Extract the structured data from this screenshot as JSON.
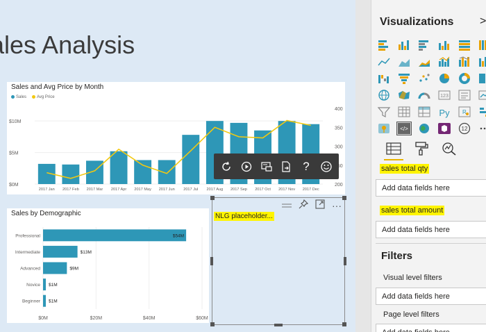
{
  "page": {
    "title": "ales Analysis"
  },
  "combo_chart": {
    "title": "Sales and Avg Price by Month",
    "legend": [
      {
        "label": "Sales",
        "color": "#2e97b7"
      },
      {
        "label": "Avg Price",
        "color": "#f2c811"
      }
    ],
    "y_left_ticks": [
      "$10M",
      "$5M",
      "$0M"
    ],
    "y_right_ticks": [
      "400",
      "350",
      "300",
      "250",
      "200"
    ]
  },
  "bar_chart": {
    "title": "Sales by Demographic",
    "x_ticks": [
      "$0M",
      "$20M",
      "$40M",
      "$60M"
    ]
  },
  "chart_data": [
    {
      "type": "bar",
      "title": "Sales and Avg Price by Month",
      "categories": [
        "2017 Jan",
        "2017 Feb",
        "2017 Mar",
        "2017 Apr",
        "2017 May",
        "2017 Jun",
        "2017 Jul",
        "2017 Aug",
        "2017 Sep",
        "2017 Oct",
        "2017 Nov",
        "2017 Dec"
      ],
      "series": [
        {
          "name": "Sales",
          "type": "bar",
          "axis": "left",
          "values": [
            3.2,
            3.1,
            3.7,
            5.2,
            3.8,
            3.8,
            7.8,
            10.0,
            9.7,
            8.5,
            10.0,
            9.5
          ]
        },
        {
          "name": "Avg Price",
          "type": "line",
          "axis": "right",
          "values": [
            230,
            215,
            235,
            292,
            250,
            228,
            288,
            350,
            325,
            322,
            368,
            355
          ]
        }
      ],
      "ylim_left": [
        0,
        12
      ],
      "ylim_right": [
        200,
        400
      ],
      "legend_position": "top-left"
    },
    {
      "type": "bar",
      "orientation": "horizontal",
      "title": "Sales by Demographic",
      "categories": [
        "Professional",
        "Intermediate",
        "Advanced",
        "Novice",
        "Beginner"
      ],
      "values": [
        54,
        13,
        9,
        1,
        1
      ],
      "value_labels": [
        "$54M",
        "$13M",
        "$9M",
        "$1M",
        "$1M"
      ],
      "xlim": [
        0,
        60
      ]
    }
  ],
  "toolbar": {
    "icons": [
      "refresh-icon",
      "play-icon",
      "screenshot-icon",
      "export-icon",
      "help-icon",
      "smiley-icon"
    ],
    "help_glyph": "?"
  },
  "nlg_visual": {
    "text": "NLG placeholder...",
    "header_icons": [
      "drag-handle-icon",
      "pin-icon",
      "focus-mode-icon",
      "more-options-icon"
    ],
    "more_glyph": "···"
  },
  "visualizations": {
    "title": "Visualizations",
    "collapse_glyph": ">",
    "custom_visual_badge": "12",
    "tabs": [
      "fields-tab",
      "format-tab",
      "analytics-tab"
    ],
    "fields": [
      {
        "label": "sales total qty",
        "placeholder": "Add data fields here"
      },
      {
        "label": "sales total amount",
        "placeholder": "Add data fields here"
      }
    ]
  },
  "filters": {
    "title": "Filters",
    "visual_level": "Visual level filters",
    "visual_level_placeholder": "Add data fields here",
    "page_level": "Page level filters",
    "page_level_placeholder": "Add data fields here"
  },
  "colors": {
    "bar": "#2e97b7",
    "line": "#f2c811",
    "highlight": "#fff400",
    "toolbar": "#3a3a3a"
  }
}
